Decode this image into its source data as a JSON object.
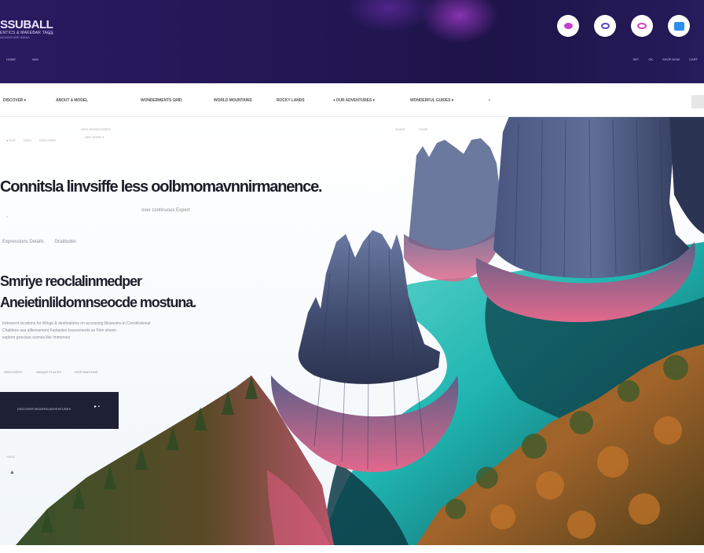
{
  "brand": {
    "logo": "SSUBALL",
    "tagline": "ENTICS & MAKEBAR TAGS",
    "subtitle": "ADVENTURE IDEAS",
    "extra": "TAG"
  },
  "top_nav": [
    "HOME",
    "NAV"
  ],
  "top_right": [
    "SET",
    "OK",
    "SHOP NOW",
    "CART"
  ],
  "icon_buttons": [
    {
      "name": "bubble-icon",
      "color": "#c63fd0"
    },
    {
      "name": "ring-icon",
      "color": "#4f4ab8"
    },
    {
      "name": "pink-ring-icon",
      "color": "#d945b6"
    },
    {
      "name": "app-icon",
      "color": "#2e8ef0"
    }
  ],
  "nav": {
    "items": [
      {
        "label": "DISCOVER ▾"
      },
      {
        "label": "ABOUT & MODEL"
      },
      {
        "label": "WONDERMENTS GRID"
      },
      {
        "label": "WORLD MOUNTAINS"
      },
      {
        "label": "ROCKY LANDS"
      },
      {
        "label": "♦ OUR ADVENTURES ▾"
      },
      {
        "label": "WONDERFUL GUIDES ▾"
      },
      {
        "label": "•"
      }
    ]
  },
  "hero": {
    "crumb_top": "NEW ADVENTURES",
    "crumb_top2": "SEE MORE ▾",
    "crumbs": [
      "● EXP",
      "VIEW",
      "DISCOVER"
    ],
    "tiny_right": [
      "GUIDE",
      "TOUR"
    ],
    "headline": "Connitsla linvsiffe less oolbmomavnnirmanence.",
    "bullet": "•",
    "sub_center": "over continuous Expert",
    "labels": [
      "Expressions Details",
      "Gratitudes"
    ],
    "headline2_line1": "Smriye reoclalinmedper",
    "headline2_line2": "Aneietinlildomnseocde mostuna.",
    "para_line1": "Indoorent locations for Winge & destinations on accessing Museums in Constitutional",
    "para_line2": "Chaldess asa allternament Fantastes traceements as Fine shown",
    "para_line3": "explore gracious scenes like Immerses",
    "tabs": [
      "DISCOVERY",
      "UNIQUE PLACES",
      "DESTINATIONS"
    ],
    "cta_text": "DISCOVER MODERN ADVENTURES",
    "cta_arrow": "▸ ▪",
    "small1": "FREE",
    "small2": "▲"
  },
  "scene_colors": {
    "water": "#1fb5b0",
    "rock": "#4f5d82",
    "rock_base": "#e06a8a",
    "forest": "#6b5a2a"
  }
}
